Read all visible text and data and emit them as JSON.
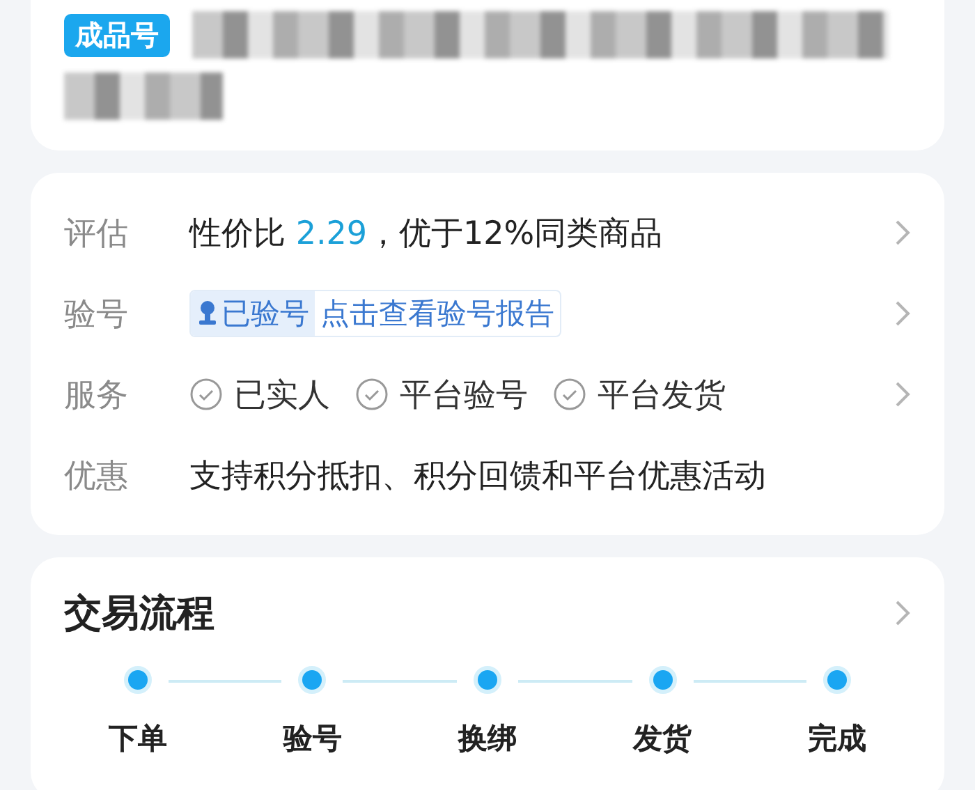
{
  "product_card": {
    "badge": "成品号"
  },
  "details": [
    {
      "kind": "rating",
      "label": "评估",
      "prefix": "性价比 ",
      "highlight": "2.29",
      "suffix": "，优于12%同类商品"
    },
    {
      "kind": "verify",
      "label": "验号",
      "status": "已验号",
      "link": "点击查看验号报告"
    },
    {
      "kind": "services",
      "label": "服务",
      "services": [
        "已实人",
        "平台验号",
        "平台发货"
      ]
    },
    {
      "kind": "text",
      "label": "优惠",
      "text": "支持积分抵扣、积分回馈和平台优惠活动"
    }
  ],
  "process": {
    "title": "交易流程",
    "steps": [
      "下单",
      "验号",
      "换绑",
      "发货",
      "完成"
    ]
  }
}
